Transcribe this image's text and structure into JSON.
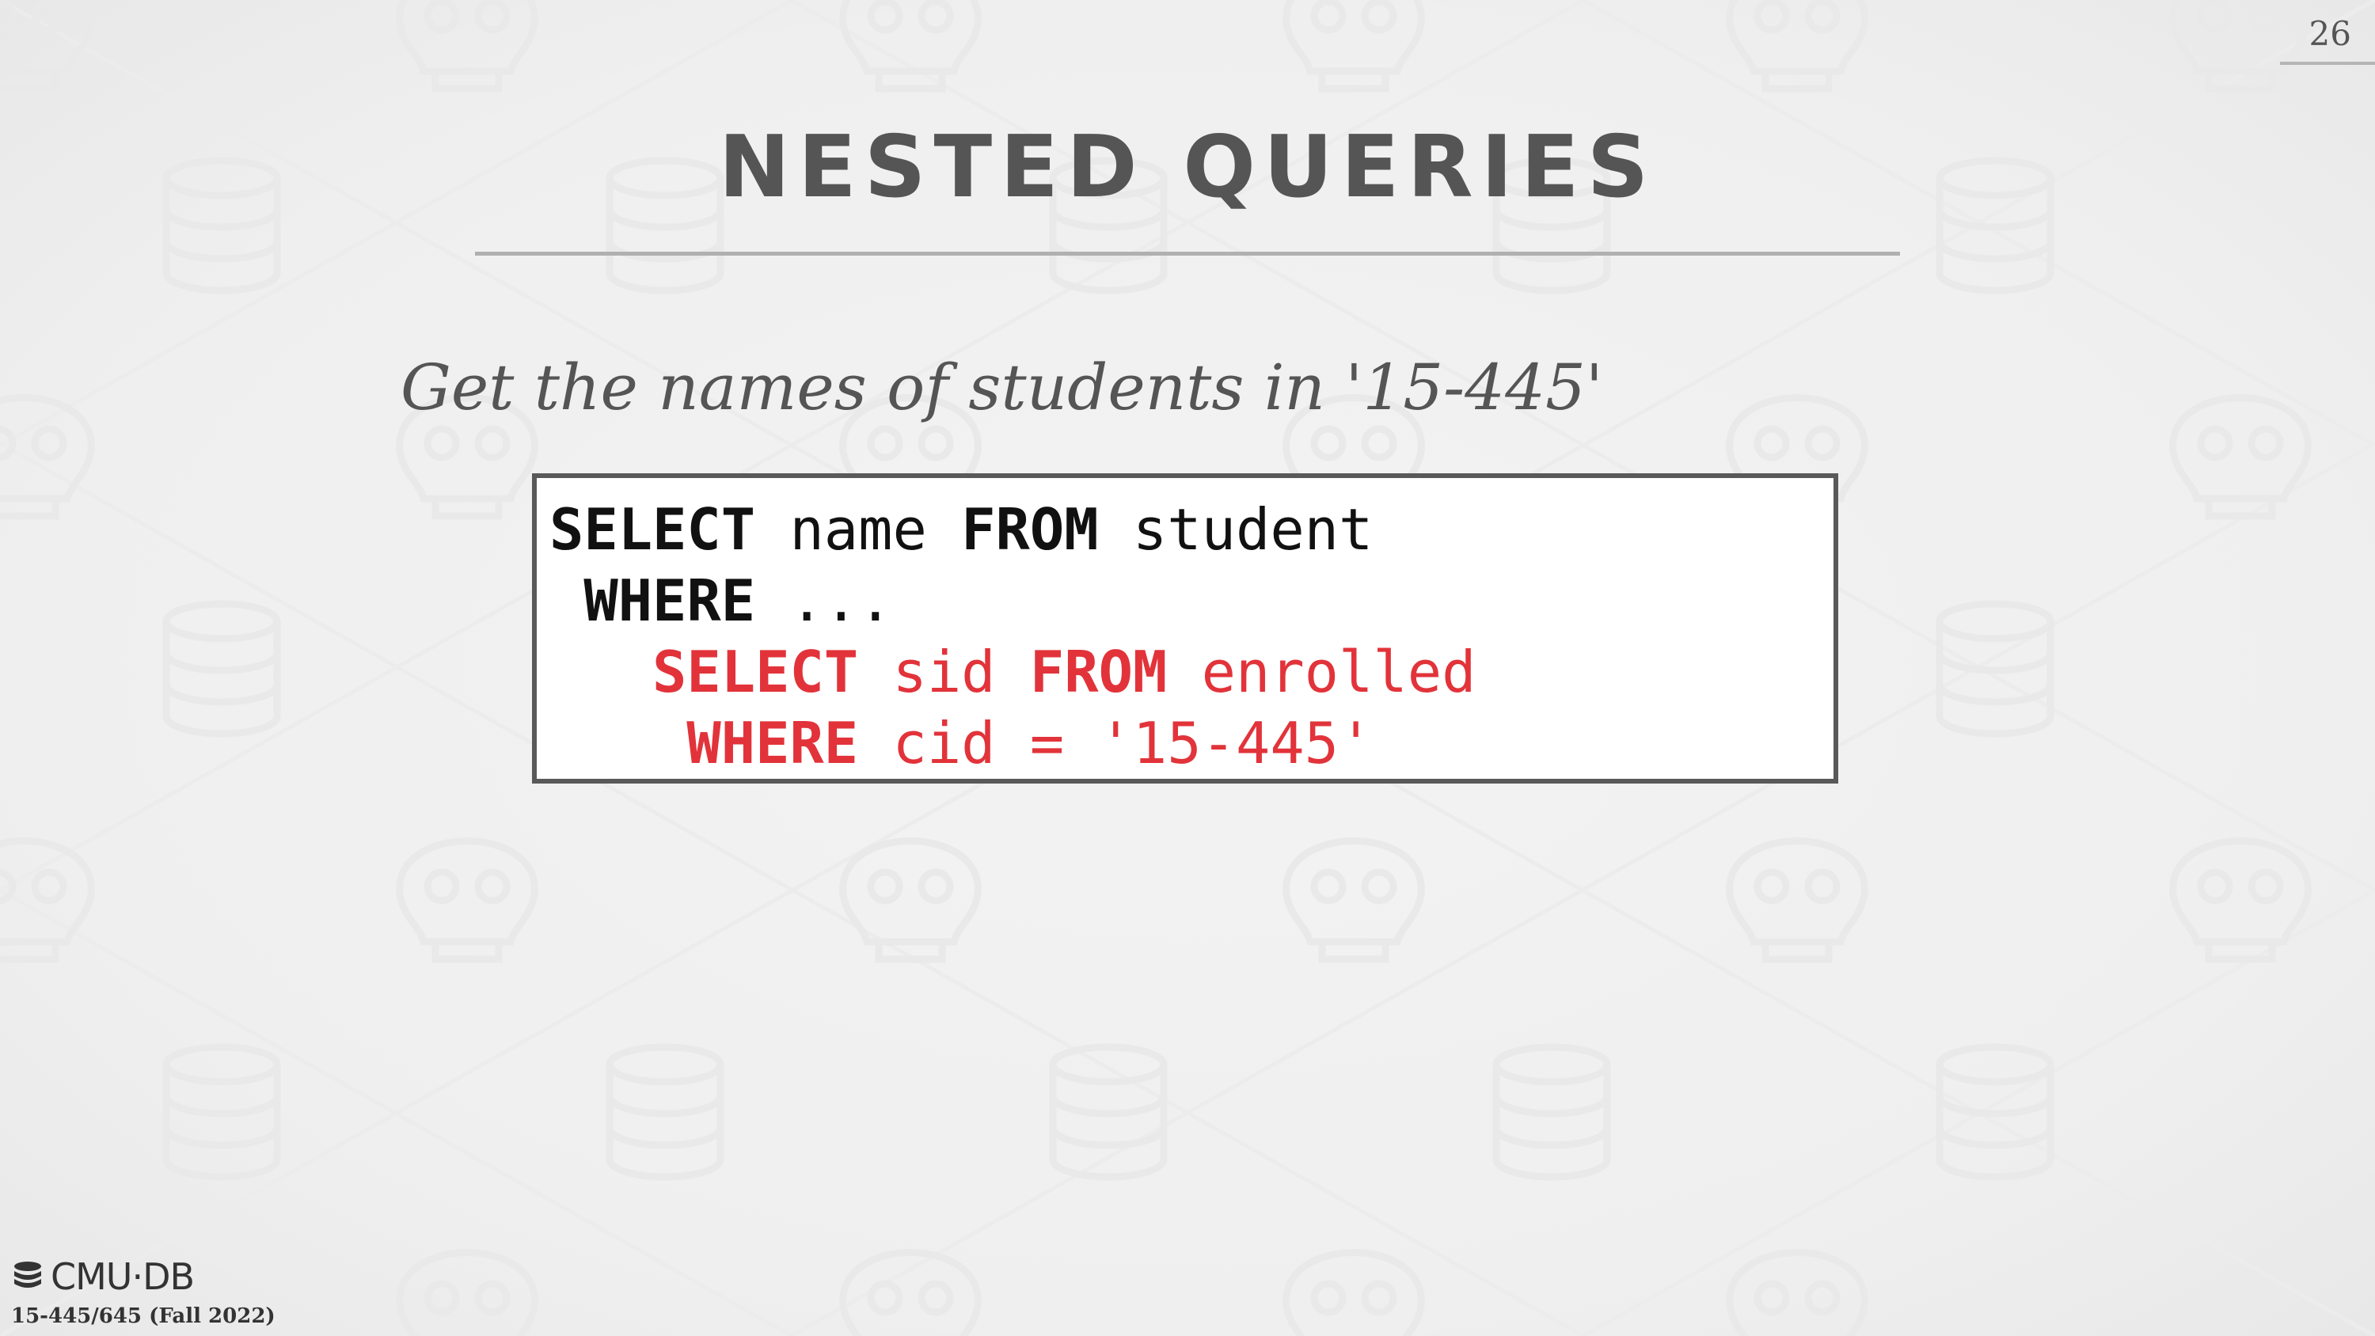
{
  "slide": {
    "page_number": "26",
    "title": "NESTED QUERIES",
    "subtitle": "Get the names of students in '15-445'",
    "code_lines": [
      {
        "indent": "",
        "tokens": [
          {
            "text": "SELECT",
            "kw": true,
            "red": false
          },
          {
            "text": " name ",
            "kw": false,
            "red": false
          },
          {
            "text": "FROM",
            "kw": true,
            "red": false
          },
          {
            "text": " student",
            "kw": false,
            "red": false
          }
        ]
      },
      {
        "indent": " ",
        "tokens": [
          {
            "text": "WHERE",
            "kw": true,
            "red": false
          },
          {
            "text": " ...",
            "kw": false,
            "red": false
          }
        ]
      },
      {
        "indent": "   ",
        "tokens": [
          {
            "text": "SELECT",
            "kw": true,
            "red": true
          },
          {
            "text": " sid ",
            "kw": false,
            "red": true
          },
          {
            "text": "FROM",
            "kw": true,
            "red": true
          },
          {
            "text": " enrolled",
            "kw": false,
            "red": true
          }
        ]
      },
      {
        "indent": "    ",
        "tokens": [
          {
            "text": "WHERE",
            "kw": true,
            "red": true
          },
          {
            "text": " cid = '15-445'",
            "kw": false,
            "red": true
          }
        ]
      }
    ]
  },
  "footer": {
    "logo_text": "CMU·DB",
    "logo_icon": "database-stack-icon",
    "course": "15-445/645 (Fall 2022)"
  },
  "colors": {
    "highlight": "#e2333a",
    "title": "#555555"
  }
}
